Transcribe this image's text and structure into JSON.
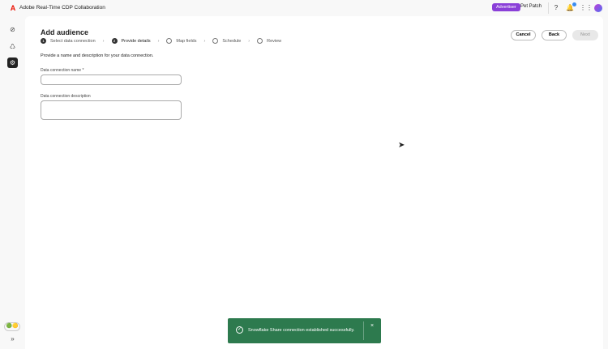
{
  "app": {
    "title": "Adobe Real-Time CDP Collaboration",
    "role_badge": "Advertiser",
    "org": "Pet Patch"
  },
  "page": {
    "title": "Add audience",
    "intro": "Provide a name and description for your data connection.",
    "steps": [
      {
        "num": "1",
        "label": "Select data connection",
        "state": "done"
      },
      {
        "num": "2",
        "label": "Provide details",
        "state": "current"
      },
      {
        "num": "",
        "label": "Map fields",
        "state": "todo"
      },
      {
        "num": "",
        "label": "Schedule",
        "state": "todo"
      },
      {
        "num": "",
        "label": "Review",
        "state": "todo"
      }
    ],
    "buttons": {
      "cancel": "Cancel",
      "back": "Back",
      "next": "Next"
    },
    "fields": {
      "name_label": "Data connection name",
      "required": "*",
      "name_value": "",
      "desc_label": "Data connection description",
      "desc_value": ""
    }
  },
  "toast": {
    "message": "Snowflake Share connection established successfully.",
    "close": "×"
  },
  "colors": {
    "accent": "#8a3fd8",
    "toast": "#2d7a4e"
  }
}
